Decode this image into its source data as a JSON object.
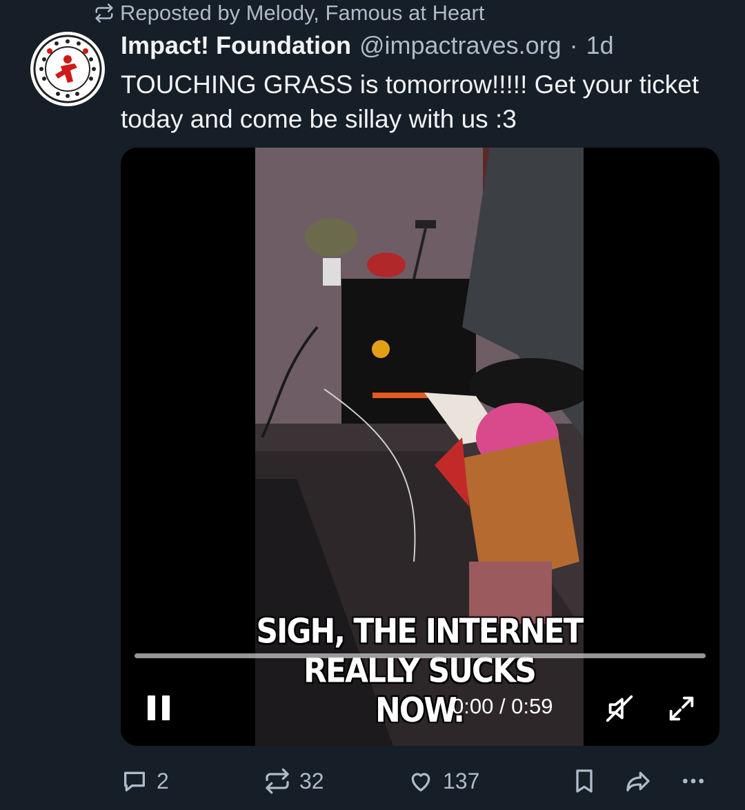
{
  "repost": {
    "text": "Reposted by Melody, Famous at Heart"
  },
  "post": {
    "author_name": "Impact! Foundation",
    "handle": "@impactraves.org",
    "separator": "·",
    "time": "1d",
    "text": "TOUCHING GRASS is tomorrow!!!!! Get your ticket today and come be sillay with us :3"
  },
  "video": {
    "caption_line1": "SIGH, THE INTERNET",
    "caption_line2": "REALLY SUCKS NOW.",
    "timecode": "0:00 / 0:59",
    "progress": 0,
    "state": "playing",
    "muted": true
  },
  "actions": {
    "reply_count": "2",
    "repost_count": "32",
    "like_count": "137"
  },
  "icons": [
    "repost-icon",
    "reply-icon",
    "like-icon",
    "bookmark-icon",
    "share-icon",
    "more-icon",
    "pause-icon",
    "mute-icon",
    "fullscreen-icon"
  ],
  "colors": {
    "background": "#161e27",
    "muted_text": "#aebbc9",
    "text": "#f1f3f5"
  }
}
